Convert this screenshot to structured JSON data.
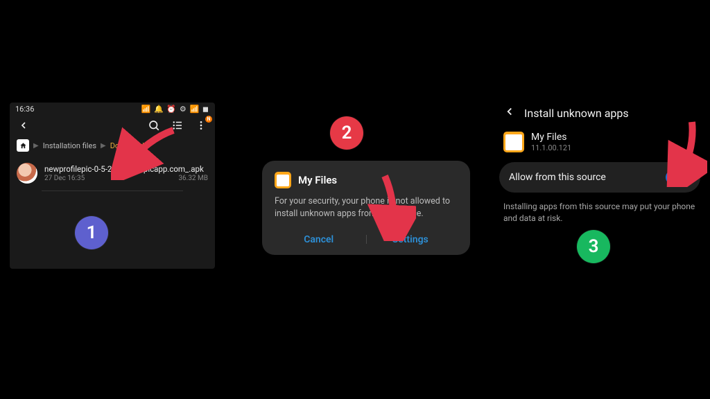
{
  "steps": {
    "one": "1",
    "two": "2",
    "three": "3"
  },
  "panel1": {
    "status_time": "16:36",
    "status_icons_hint": "📶 🔔 ⏰ ⚙ 📶 ◼",
    "breadcrumb": {
      "root": "Installation files",
      "current": "Download"
    },
    "file": {
      "name": "newprofilepic-0-5-25-n…ofilepicapp.com_.apk",
      "date": "27 Dec 16:35",
      "size": "36.32 MB"
    }
  },
  "panel2": {
    "title": "My Files",
    "body": "For your security, your phone is not allowed to install unknown apps from this source.",
    "cancel": "Cancel",
    "settings": "Settings"
  },
  "panel3": {
    "header": "Install unknown apps",
    "app_name": "My Files",
    "app_version": "11.1.00.121",
    "toggle_label": "Allow from this source",
    "warning": "Installing apps from this source may put your phone and data at risk."
  }
}
